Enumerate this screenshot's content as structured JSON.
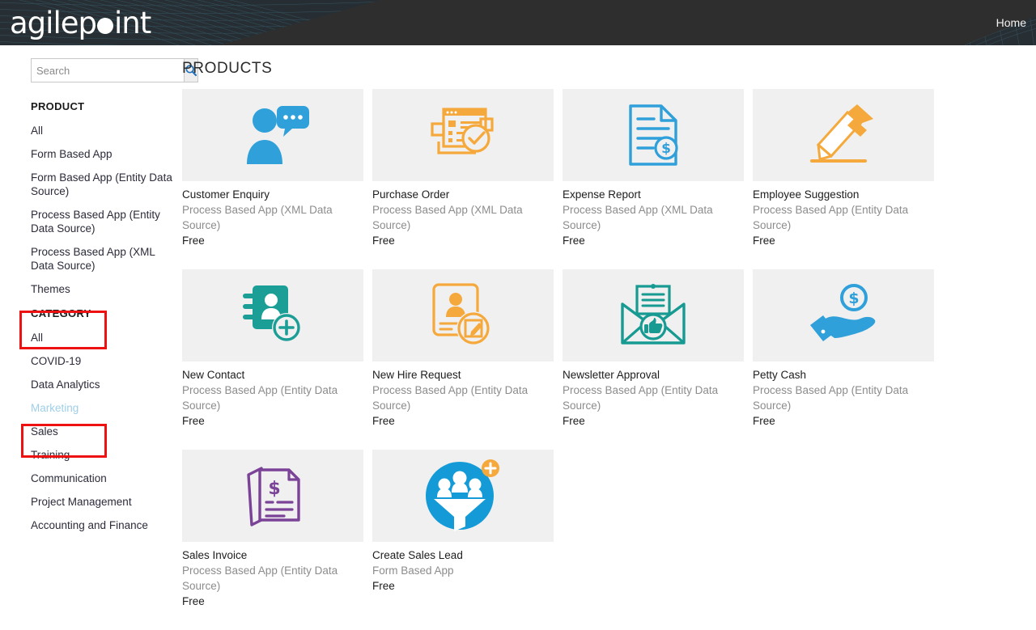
{
  "header": {
    "logo_text": "agilep",
    "logo_text_end": "int",
    "logo_name": "agilepoint",
    "home_label": "Home",
    "bg_color": "#2e2e2e",
    "mesh_color": "#2b5f75"
  },
  "sidebar": {
    "search": {
      "placeholder": "Search",
      "value": "",
      "button_icon": "search-icon"
    },
    "product_facet": {
      "title": "PRODUCT",
      "items": [
        {
          "label": "All",
          "selected": false
        },
        {
          "label": "Form Based App",
          "selected": false
        },
        {
          "label": "Form Based App (Entity Data Source)",
          "selected": false
        },
        {
          "label": "Process Based App (Entity Data Source)",
          "selected": false
        },
        {
          "label": "Process Based App (XML Data Source)",
          "selected": false
        },
        {
          "label": "Themes",
          "selected": false
        }
      ]
    },
    "category_facet": {
      "title": "CATEGORY",
      "items": [
        {
          "label": "All",
          "selected": false
        },
        {
          "label": "COVID-19",
          "selected": false
        },
        {
          "label": "Data Analytics",
          "selected": false
        },
        {
          "label": "Marketing",
          "selected": true
        },
        {
          "label": "Sales",
          "selected": false
        },
        {
          "label": "Training",
          "selected": false
        },
        {
          "label": "Communication",
          "selected": false
        },
        {
          "label": "Project Management",
          "selected": false
        },
        {
          "label": "Accounting and Finance",
          "selected": false
        }
      ]
    },
    "highlight_color": "#9ecfe8"
  },
  "annotations": {
    "color": "#ee1111",
    "boxes": [
      {
        "name": "category-heading-highlight",
        "target": "CATEGORY"
      },
      {
        "name": "marketing-item-highlight",
        "target": "Marketing"
      }
    ]
  },
  "main": {
    "title": "PRODUCTS",
    "cards": [
      {
        "name": "Customer Enquiry",
        "type": "Process Based App (XML Data Source)",
        "price": "Free",
        "icon": "person-speech-bubble-icon",
        "icon_color": "#30a0da"
      },
      {
        "name": "Purchase Order",
        "type": "Process Based App (XML Data Source)",
        "price": "Free",
        "icon": "order-form-check-icon",
        "icon_color": "#f5a93c"
      },
      {
        "name": "Expense Report",
        "type": "Process Based App (XML Data Source)",
        "price": "Free",
        "icon": "document-dollar-icon",
        "icon_color": "#30a0da"
      },
      {
        "name": "Employee Suggestion",
        "type": "Process Based App (Entity Data Source)",
        "price": "Free",
        "icon": "highlighter-pen-icon",
        "icon_color": "#f5a93c"
      },
      {
        "name": "New Contact",
        "type": "Process Based App (Entity Data Source)",
        "price": "Free",
        "icon": "address-book-plus-icon",
        "icon_color": "#1a9e96"
      },
      {
        "name": "New Hire Request",
        "type": "Process Based App (Entity Data Source)",
        "price": "Free",
        "icon": "id-card-edit-icon",
        "icon_color": "#f5a93c"
      },
      {
        "name": "Newsletter Approval",
        "type": "Process Based App (Entity Data Source)",
        "price": "Free",
        "icon": "envelope-thumbsup-icon",
        "icon_color": "#169a92"
      },
      {
        "name": "Petty Cash",
        "type": "Process Based App (Entity Data Source)",
        "price": "Free",
        "icon": "hand-coin-icon",
        "icon_color": "#30a0da"
      },
      {
        "name": "Sales Invoice",
        "type": "Process Based App (Entity Data Source)",
        "price": "Free",
        "icon": "invoice-dollar-icon",
        "icon_color": "#7b4397"
      },
      {
        "name": "Create Sales Lead",
        "type": "Form Based App",
        "price": "Free",
        "icon": "sales-funnel-people-icon",
        "icon_color": "#149bd7"
      }
    ]
  }
}
